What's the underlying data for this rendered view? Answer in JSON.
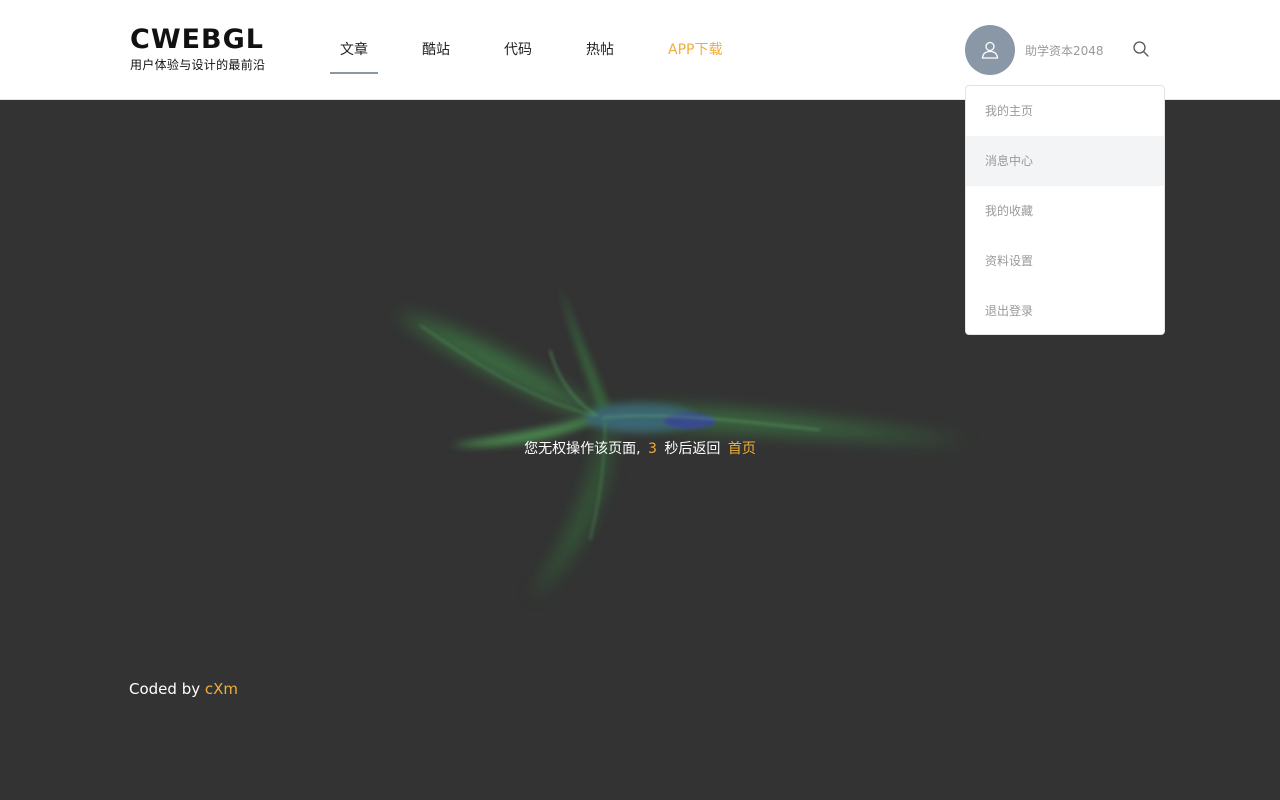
{
  "header": {
    "logo_title": "CWEBGL",
    "logo_subtitle": "用户体验与设计的最前沿",
    "nav": [
      {
        "label": "文章"
      },
      {
        "label": "酷站"
      },
      {
        "label": "代码"
      },
      {
        "label": "热帖"
      },
      {
        "label": "APP下载"
      }
    ],
    "active_nav": "文章",
    "username": "助学资本2048",
    "avatar_icon": "user-icon",
    "search_icon": "search-icon"
  },
  "dropdown": {
    "items": [
      {
        "label": "我的主页"
      },
      {
        "label": "消息中心"
      },
      {
        "label": "我的收藏"
      },
      {
        "label": "资料设置"
      },
      {
        "label": "退出登录"
      }
    ],
    "hovered": "消息中心"
  },
  "main": {
    "message_prefix": "您无权操作该页面,",
    "countdown": "3",
    "message_suffix": "秒后返回",
    "home_link": "首页"
  },
  "footer": {
    "coded_by": "Coded by",
    "author": "cXm"
  },
  "colors": {
    "accent": "#f0ad3a",
    "background": "#333333",
    "avatar": "#8a97a6",
    "menu_hover": "#f3f4f6"
  }
}
